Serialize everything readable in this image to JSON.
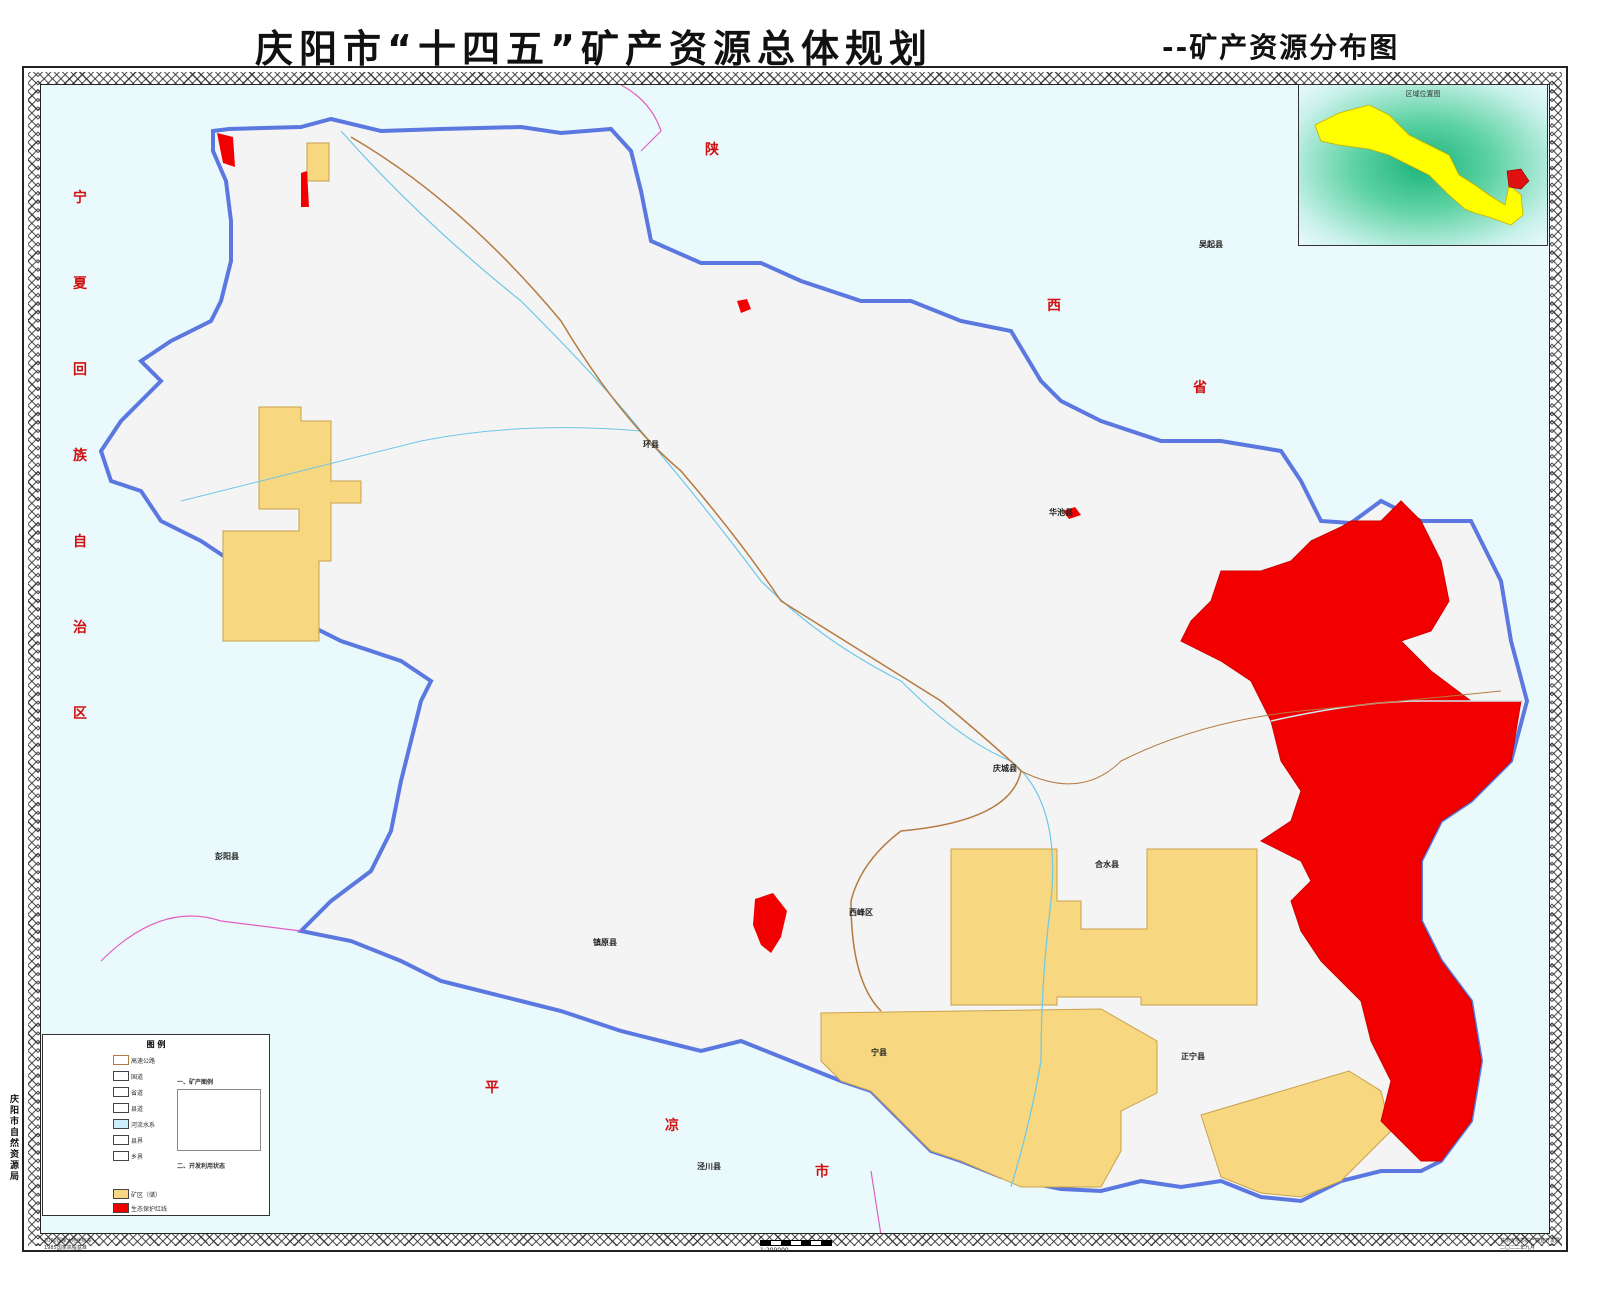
{
  "title": {
    "main": "庆阳市“十四五”矿产资源总体规划",
    "sub": "--矿产资源分布图"
  },
  "neighbor_labels": {
    "ningxia": [
      "宁",
      "夏",
      "回",
      "族",
      "自",
      "治",
      "区"
    ],
    "shaanxi": [
      "陕",
      "西",
      "省"
    ],
    "pingliang": [
      "平",
      "凉",
      "市"
    ]
  },
  "county_labels": [
    {
      "name": "环县"
    },
    {
      "name": "庆城县"
    },
    {
      "name": "华池县"
    },
    {
      "name": "合水县"
    },
    {
      "name": "西峰区"
    },
    {
      "name": "镇原县"
    },
    {
      "name": "宁县"
    },
    {
      "name": "正宁县"
    },
    {
      "name": "彭阳县"
    },
    {
      "name": "泾川县"
    },
    {
      "name": "吴起县"
    }
  ],
  "inset": {
    "title": "区域位置图"
  },
  "legend": {
    "title": "图 例",
    "mineral_section_title": "一、矿产图例",
    "development_section_title": "二、开发利用状态",
    "items": [
      {
        "label": "高速公路"
      },
      {
        "label": "国道"
      },
      {
        "label": "省道"
      },
      {
        "label": "县道"
      },
      {
        "label": "河流水系"
      },
      {
        "label": "县界"
      },
      {
        "label": "乡界"
      },
      {
        "label": "矿区（储）"
      },
      {
        "label": "生态保护红线"
      }
    ]
  },
  "side_caption": [
    "庆",
    "阳",
    "市",
    "自",
    "然",
    "资",
    "源",
    "局"
  ],
  "footer": {
    "left_line1": "2000国家大地坐标系",
    "left_line2": "1985国家高程基准",
    "scale": "1:200000",
    "right_line1": "甘肃省地质矿产勘查开发局",
    "right_line2": "二〇二二年九月"
  },
  "colors": {
    "ecological_red_line": "#f20000",
    "mining_area": "#f7d77f",
    "city_fill": "#f4f4f4",
    "boundary": "#5b78e0",
    "water": "#eaf9fb"
  }
}
